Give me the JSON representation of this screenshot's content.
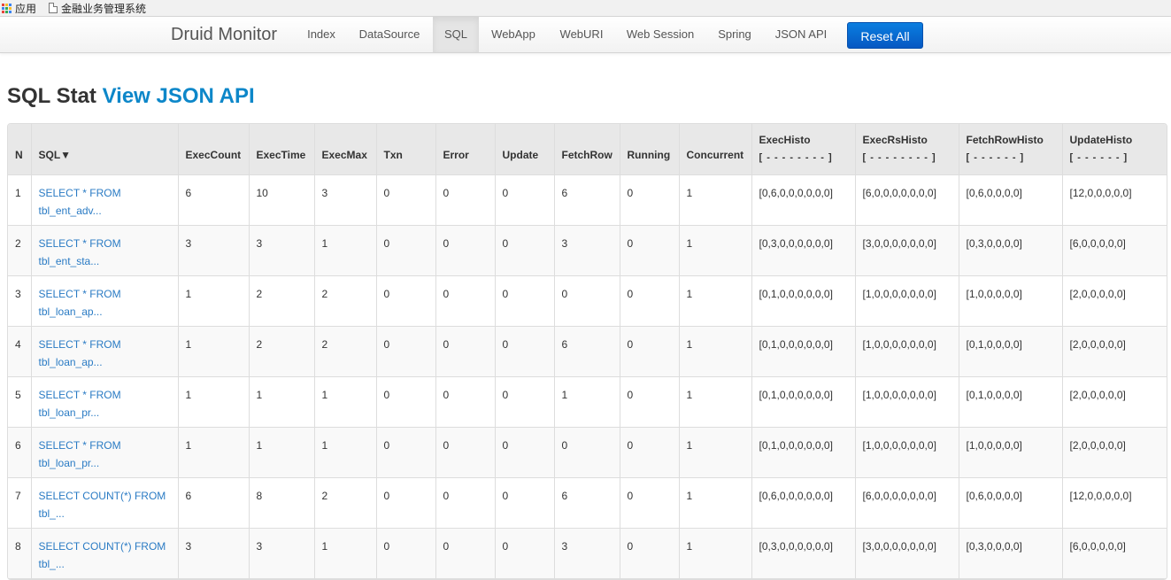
{
  "bookmarks": {
    "apps_label": "应用",
    "page_label": "金融业务管理系统",
    "apps_colors": [
      "#e8453c",
      "#f9bb2d",
      "#3b84f2",
      "#3b84f2",
      "#34a853",
      "#f9bb2d",
      "#e8453c",
      "#34a853",
      "#3b84f2"
    ]
  },
  "navbar": {
    "brand": "Druid Monitor",
    "items": [
      "Index",
      "DataSource",
      "SQL",
      "WebApp",
      "WebURI",
      "Web Session",
      "Spring",
      "JSON API"
    ],
    "active": "SQL",
    "reset_label": "Reset All",
    "accent": "#0a6fd6"
  },
  "heading": {
    "title": "SQL Stat",
    "link": "View JSON API",
    "link_color": "#0d87c9"
  },
  "table": {
    "headers": [
      "N",
      "SQL▼",
      "ExecCount",
      "ExecTime",
      "ExecMax",
      "Txn",
      "Error",
      "Update",
      "FetchRow",
      "Running",
      "Concurrent",
      "ExecHisto",
      "ExecRsHisto",
      "FetchRowHisto",
      "UpdateHisto"
    ],
    "histo_subs": [
      "[ - - - - - - - - ]",
      "[ - - - - - - - - ]",
      "[ - - - - - - ]",
      "[ - - - - - - ]"
    ],
    "rows": [
      {
        "n": "1",
        "sql1": "SELECT * FROM",
        "sql2": "tbl_ent_adv...",
        "exec_count": "6",
        "exec_time": "10",
        "exec_max": "3",
        "txn": "0",
        "error": "0",
        "update": "0",
        "fetch_row": "6",
        "running": "0",
        "concurrent": "1",
        "exec_histo": "[0,6,0,0,0,0,0,0]",
        "exec_rs_histo": "[6,0,0,0,0,0,0,0]",
        "fetch_row_histo": "[0,6,0,0,0,0]",
        "update_histo": "[12,0,0,0,0,0]"
      },
      {
        "n": "2",
        "sql1": "SELECT * FROM",
        "sql2": "tbl_ent_sta...",
        "exec_count": "3",
        "exec_time": "3",
        "exec_max": "1",
        "txn": "0",
        "error": "0",
        "update": "0",
        "fetch_row": "3",
        "running": "0",
        "concurrent": "1",
        "exec_histo": "[0,3,0,0,0,0,0,0]",
        "exec_rs_histo": "[3,0,0,0,0,0,0,0]",
        "fetch_row_histo": "[0,3,0,0,0,0]",
        "update_histo": "[6,0,0,0,0,0]"
      },
      {
        "n": "3",
        "sql1": "SELECT * FROM",
        "sql2": "tbl_loan_ap...",
        "exec_count": "1",
        "exec_time": "2",
        "exec_max": "2",
        "txn": "0",
        "error": "0",
        "update": "0",
        "fetch_row": "0",
        "running": "0",
        "concurrent": "1",
        "exec_histo": "[0,1,0,0,0,0,0,0]",
        "exec_rs_histo": "[1,0,0,0,0,0,0,0]",
        "fetch_row_histo": "[1,0,0,0,0,0]",
        "update_histo": "[2,0,0,0,0,0]"
      },
      {
        "n": "4",
        "sql1": "SELECT * FROM",
        "sql2": "tbl_loan_ap...",
        "exec_count": "1",
        "exec_time": "2",
        "exec_max": "2",
        "txn": "0",
        "error": "0",
        "update": "0",
        "fetch_row": "6",
        "running": "0",
        "concurrent": "1",
        "exec_histo": "[0,1,0,0,0,0,0,0]",
        "exec_rs_histo": "[1,0,0,0,0,0,0,0]",
        "fetch_row_histo": "[0,1,0,0,0,0]",
        "update_histo": "[2,0,0,0,0,0]"
      },
      {
        "n": "5",
        "sql1": "SELECT * FROM",
        "sql2": "tbl_loan_pr...",
        "exec_count": "1",
        "exec_time": "1",
        "exec_max": "1",
        "txn": "0",
        "error": "0",
        "update": "0",
        "fetch_row": "1",
        "running": "0",
        "concurrent": "1",
        "exec_histo": "[0,1,0,0,0,0,0,0]",
        "exec_rs_histo": "[1,0,0,0,0,0,0,0]",
        "fetch_row_histo": "[0,1,0,0,0,0]",
        "update_histo": "[2,0,0,0,0,0]"
      },
      {
        "n": "6",
        "sql1": "SELECT * FROM",
        "sql2": "tbl_loan_pr...",
        "exec_count": "1",
        "exec_time": "1",
        "exec_max": "1",
        "txn": "0",
        "error": "0",
        "update": "0",
        "fetch_row": "0",
        "running": "0",
        "concurrent": "1",
        "exec_histo": "[0,1,0,0,0,0,0,0]",
        "exec_rs_histo": "[1,0,0,0,0,0,0,0]",
        "fetch_row_histo": "[1,0,0,0,0,0]",
        "update_histo": "[2,0,0,0,0,0]"
      },
      {
        "n": "7",
        "sql1": "SELECT COUNT(*) FROM",
        "sql2": "tbl_...",
        "exec_count": "6",
        "exec_time": "8",
        "exec_max": "2",
        "txn": "0",
        "error": "0",
        "update": "0",
        "fetch_row": "6",
        "running": "0",
        "concurrent": "1",
        "exec_histo": "[0,6,0,0,0,0,0,0]",
        "exec_rs_histo": "[6,0,0,0,0,0,0,0]",
        "fetch_row_histo": "[0,6,0,0,0,0]",
        "update_histo": "[12,0,0,0,0,0]"
      },
      {
        "n": "8",
        "sql1": "SELECT COUNT(*) FROM",
        "sql2": "tbl_...",
        "exec_count": "3",
        "exec_time": "3",
        "exec_max": "1",
        "txn": "0",
        "error": "0",
        "update": "0",
        "fetch_row": "3",
        "running": "0",
        "concurrent": "1",
        "exec_histo": "[0,3,0,0,0,0,0,0]",
        "exec_rs_histo": "[3,0,0,0,0,0,0,0]",
        "fetch_row_histo": "[0,3,0,0,0,0]",
        "update_histo": "[6,0,0,0,0,0]"
      }
    ]
  }
}
